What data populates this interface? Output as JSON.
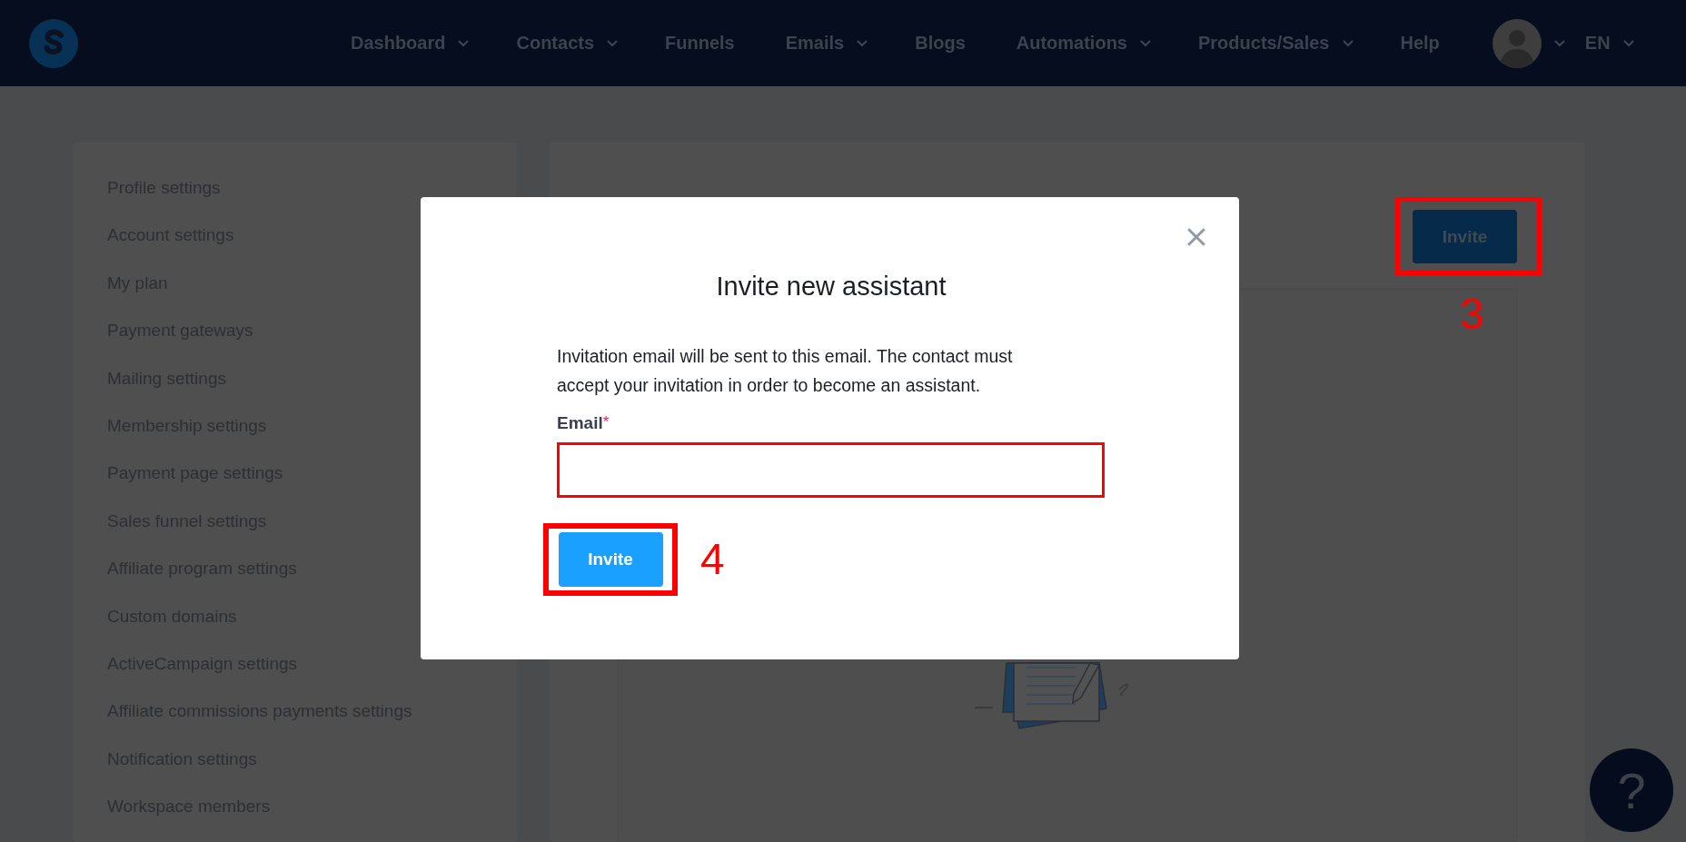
{
  "nav": {
    "items": [
      {
        "label": "Dashboard",
        "dropdown": true
      },
      {
        "label": "Contacts",
        "dropdown": true
      },
      {
        "label": "Funnels",
        "dropdown": false
      },
      {
        "label": "Emails",
        "dropdown": true
      },
      {
        "label": "Blogs",
        "dropdown": false
      },
      {
        "label": "Automations",
        "dropdown": true
      },
      {
        "label": "Products/Sales",
        "dropdown": true
      },
      {
        "label": "Help",
        "dropdown": false
      }
    ],
    "language": "EN"
  },
  "sidebar": {
    "items": [
      "Profile settings",
      "Account settings",
      "My plan",
      "Payment gateways",
      "Mailing settings",
      "Membership settings",
      "Payment page settings",
      "Sales funnel settings",
      "Affiliate program settings",
      "Custom domains",
      "ActiveCampaign settings",
      "Affiliate commissions payments settings",
      "Notification settings",
      "Workspace members"
    ]
  },
  "main": {
    "invite_button": "Invite",
    "step_mark": "3"
  },
  "modal": {
    "title": "Invite new assistant",
    "description": "Invitation email will be sent to this email. The contact must accept your invitation in order to become an assistant.",
    "email_label": "Email",
    "required_marker": "*",
    "submit_button": "Invite",
    "step_mark": "4"
  },
  "help_button": {
    "label": "?"
  }
}
